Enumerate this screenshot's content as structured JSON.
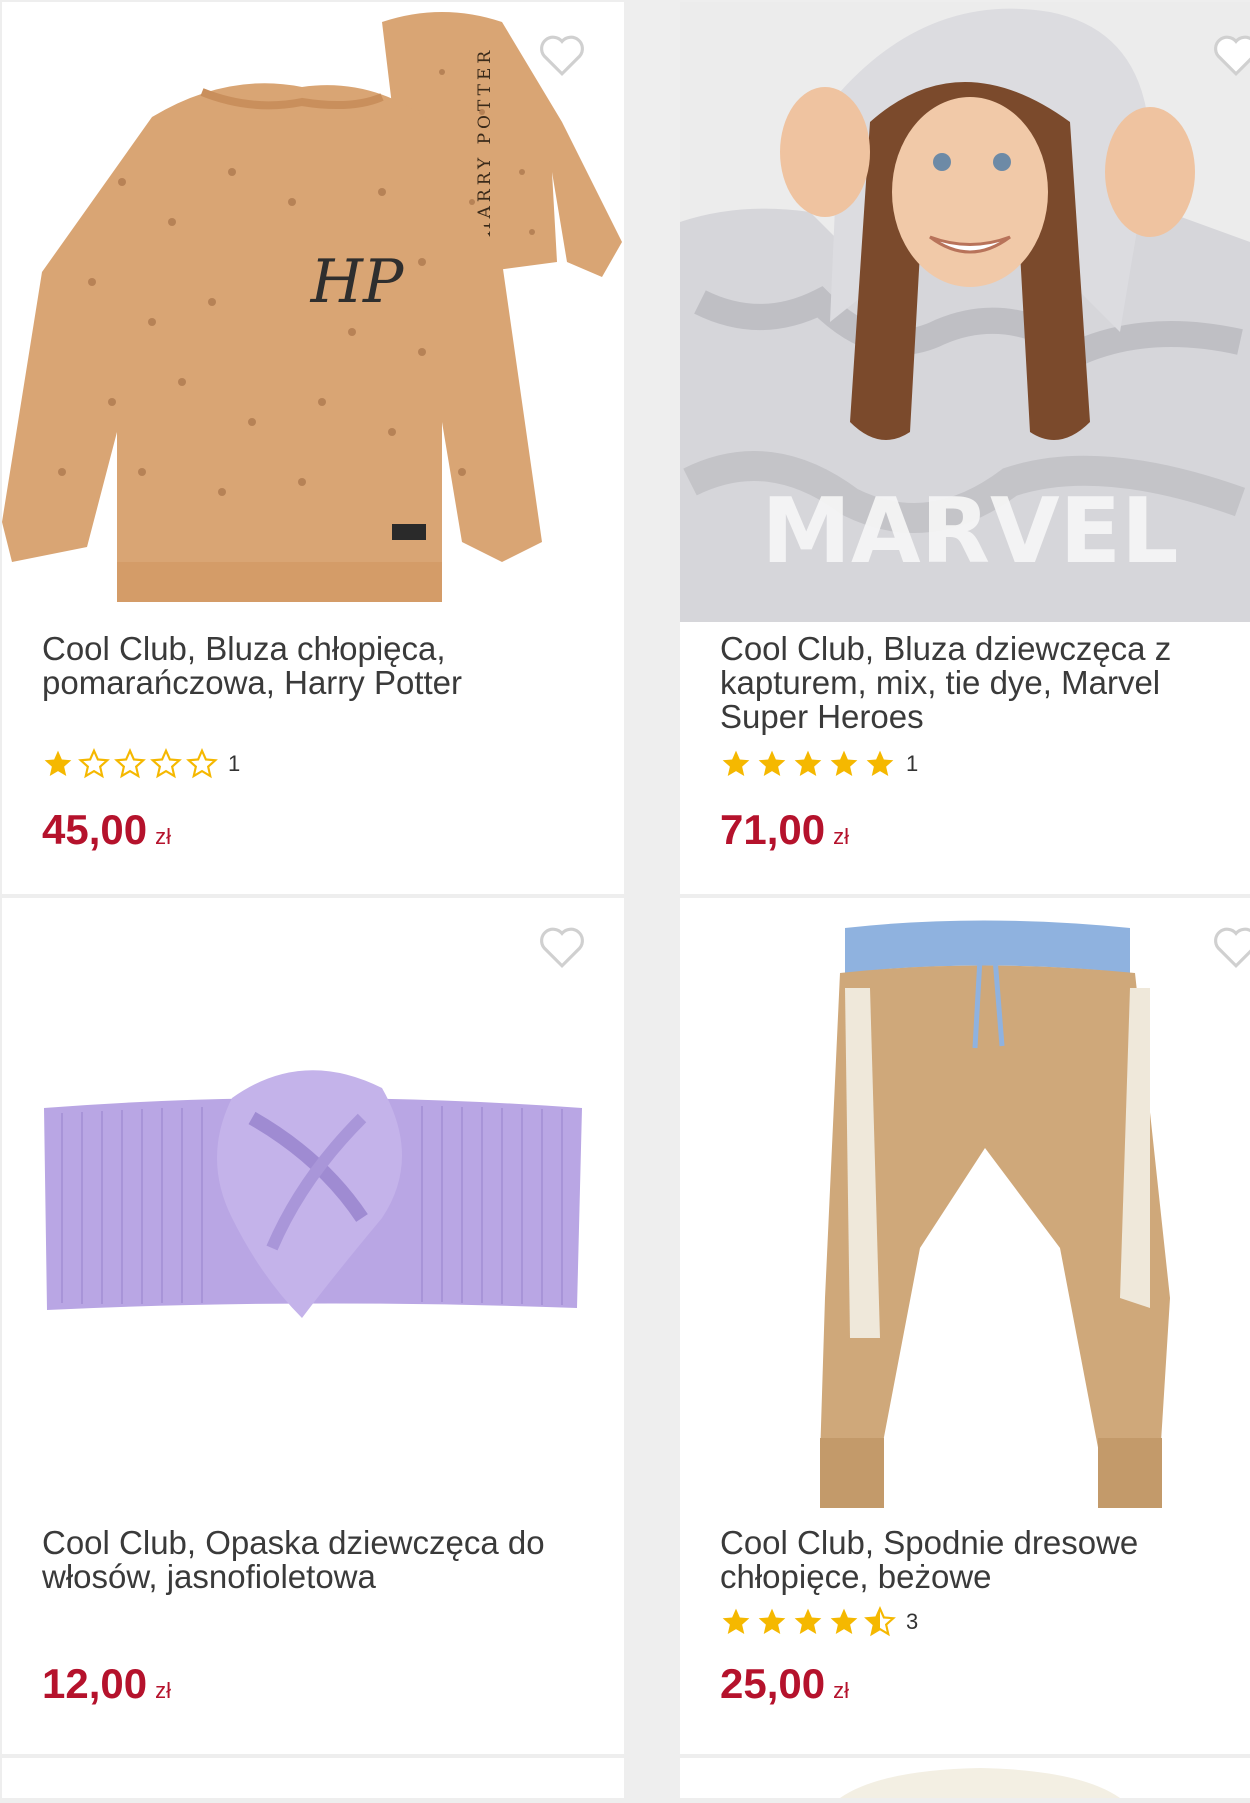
{
  "products": [
    {
      "title": "Cool Club, Bluza chłopięca, pomarańczowa, Harry Potter",
      "rating": 1,
      "reviews": "1",
      "price": "45,00",
      "currency": "zł",
      "image_print": "HARRY POTTER",
      "image_logo": "HP"
    },
    {
      "title": "Cool Club, Bluza dziewczęca z kapturem, mix, tie dye, Marvel Super Heroes",
      "rating": 5,
      "reviews": "1",
      "price": "71,00",
      "currency": "zł",
      "image_print": "MARVEL"
    },
    {
      "title": "Cool Club, Opaska dziewczęca do włosów, jasnofioletowa",
      "price": "12,00",
      "currency": "zł"
    },
    {
      "title": "Cool Club, Spodnie dresowe chłopięce, beżowe",
      "rating": 4.5,
      "reviews": "3",
      "price": "25,00",
      "currency": "zł"
    }
  ],
  "colors": {
    "price": "#b5122c",
    "star": "#f5b800",
    "background": "#eeeeee"
  },
  "icons": {
    "favorite": "heart-outline-icon",
    "rating": "star-icon"
  }
}
